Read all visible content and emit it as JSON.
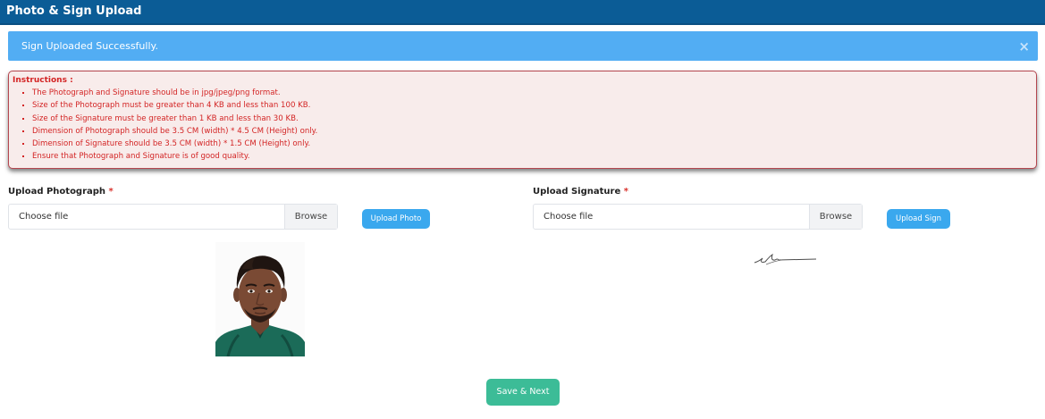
{
  "header": {
    "title": "Photo & Sign Upload"
  },
  "alert": {
    "message": "Sign Uploaded Successfully.",
    "close_label": "×"
  },
  "instructions": {
    "title": "Instructions :",
    "items": [
      "The Photograph and Signature should be in jpg/jpeg/png format.",
      "Size of the Photograph must be greater than 4 KB and less than 100 KB.",
      "Size of the Signature must be greater than 1 KB and less than 30 KB.",
      "Dimension of Photograph should be 3.5 CM (width) * 4.5 CM (Height) only.",
      "Dimension of Signature should be 3.5 CM (width) * 1.5 CM (Height) only.",
      "Ensure that Photograph and Signature is of good quality."
    ]
  },
  "photo_section": {
    "label": "Upload Photograph",
    "required_mark": "*",
    "file_text": "Choose file",
    "browse_label": "Browse",
    "upload_button": "Upload Photo"
  },
  "sign_section": {
    "label": "Upload Signature",
    "required_mark": "*",
    "file_text": "Choose file",
    "browse_label": "Browse",
    "upload_button": "Upload Sign"
  },
  "actions": {
    "save_next": "Save & Next"
  },
  "colors": {
    "header_bg": "#0b5c96",
    "alert_bg": "#52adf3",
    "instructions_text": "#d32424",
    "upload_button": "#3aa8ee",
    "save_button": "#3cbc97"
  }
}
